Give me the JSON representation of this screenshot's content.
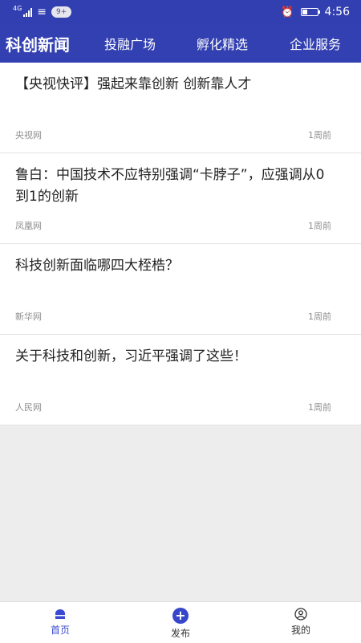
{
  "status_bar": {
    "network": "4G",
    "notification_count": "9+",
    "battery_level": 0.35,
    "time": "4:56"
  },
  "header": {
    "brand": "科创新闻",
    "tabs": [
      {
        "label": "投融广场"
      },
      {
        "label": "孵化精选"
      },
      {
        "label": "企业服务"
      }
    ]
  },
  "news": [
    {
      "title": "【央视快评】强起来靠创新 创新靠人才",
      "source": "央视网",
      "time": "1周前"
    },
    {
      "title": "鲁白：中国技术不应特别强调“卡脖子”，应强调从0到1的创新",
      "source": "凤凰网",
      "time": "1周前"
    },
    {
      "title": "科技创新面临哪四大桎梏？",
      "source": "新华网",
      "time": "1周前"
    },
    {
      "title": "关于科技和创新，习近平强调了这些！",
      "source": "人民网",
      "time": "1周前"
    }
  ],
  "tabbar": {
    "items": [
      {
        "label": "首页",
        "icon": "home-icon"
      },
      {
        "label": "发布",
        "icon": "plus-icon"
      },
      {
        "label": "我的",
        "icon": "user-icon"
      }
    ]
  },
  "colors": {
    "primary": "#3240b2",
    "active": "#3b4bd1"
  }
}
